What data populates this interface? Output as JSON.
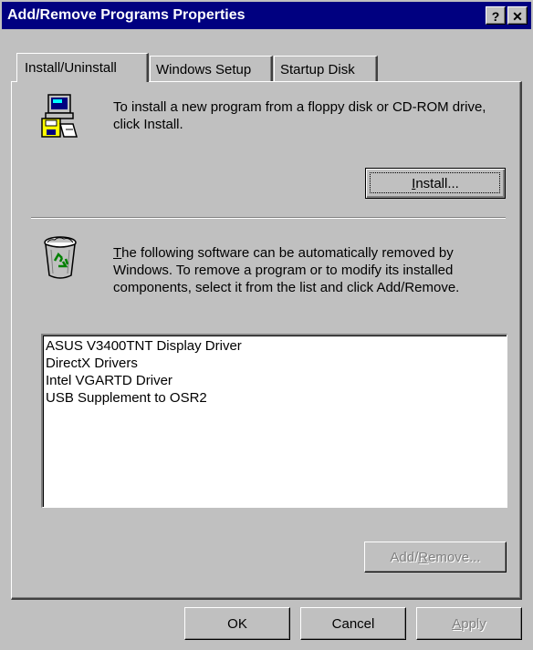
{
  "window": {
    "title": "Add/Remove Programs Properties",
    "help_button": "?",
    "close_button": "✕"
  },
  "tabs": [
    {
      "label": "Install/Uninstall",
      "active": true
    },
    {
      "label": "Windows Setup",
      "active": false
    },
    {
      "label": "Startup Disk",
      "active": false
    }
  ],
  "install_section": {
    "icon": "computer-install-icon",
    "description": "To install a new program from a floppy disk or CD-ROM drive, click Install.",
    "button": {
      "before": "",
      "accel": "I",
      "after": "nstall..."
    }
  },
  "uninstall_section": {
    "icon": "recycle-bin-icon",
    "description": {
      "accel": "T",
      "rest": "he following software can be automatically removed by Windows. To remove a program or to modify its installed components, select it from the list and click Add/Remove."
    },
    "programs": [
      "ASUS V3400TNT Display Driver",
      "DirectX Drivers",
      "Intel VGARTD Driver",
      "USB Supplement to OSR2"
    ],
    "add_remove_button": {
      "before": "Add/",
      "accel": "R",
      "after": "emove...",
      "enabled": false
    }
  },
  "footer": {
    "ok": "OK",
    "cancel": "Cancel",
    "apply": {
      "before": "",
      "accel": "A",
      "after": "pply",
      "enabled": false
    }
  },
  "colors": {
    "titlebar": "#000080",
    "face": "#c0c0c0",
    "disabled_text": "#808080"
  }
}
